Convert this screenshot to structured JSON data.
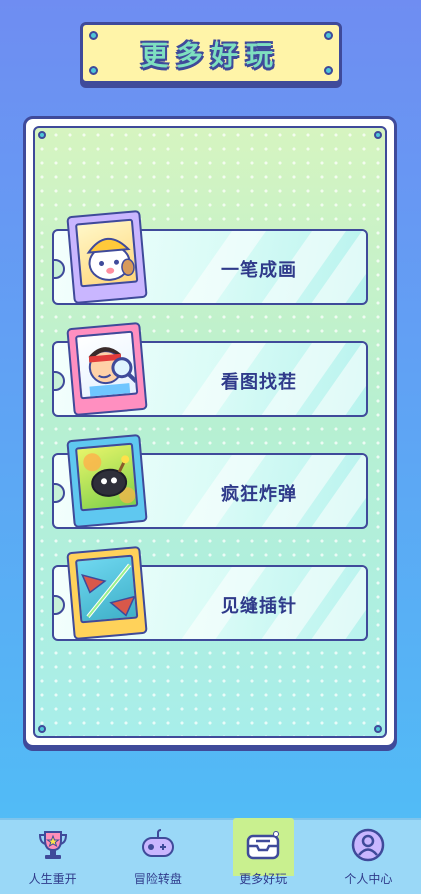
{
  "header": {
    "title": "更多好玩"
  },
  "games": [
    {
      "name": "一笔成画",
      "thumb_color": "#c9b6ff",
      "icon": "dog-with-hardhat-icon"
    },
    {
      "name": "看图找茬",
      "thumb_color": "#ff8fc0",
      "icon": "boy-with-magnifier-icon"
    },
    {
      "name": "疯狂炸弹",
      "thumb_color": "#5fc8f0",
      "icon": "bomb-icon"
    },
    {
      "name": "见缝插针",
      "thumb_color": "#ffd25a",
      "icon": "needle-icon"
    }
  ],
  "tabbar": {
    "items": [
      {
        "label": "人生重开",
        "icon": "trophy-icon",
        "active": false
      },
      {
        "label": "冒险转盘",
        "icon": "gamepad-icon",
        "active": false
      },
      {
        "label": "更多好玩",
        "icon": "inbox-icon",
        "active": true
      },
      {
        "label": "个人中心",
        "icon": "user-icon",
        "active": false
      }
    ]
  },
  "colors": {
    "outline": "#3f4a9a",
    "bg_top": "#6f8df2",
    "bg_bottom": "#4fc0f6",
    "tab_active": "#c9f08f"
  }
}
